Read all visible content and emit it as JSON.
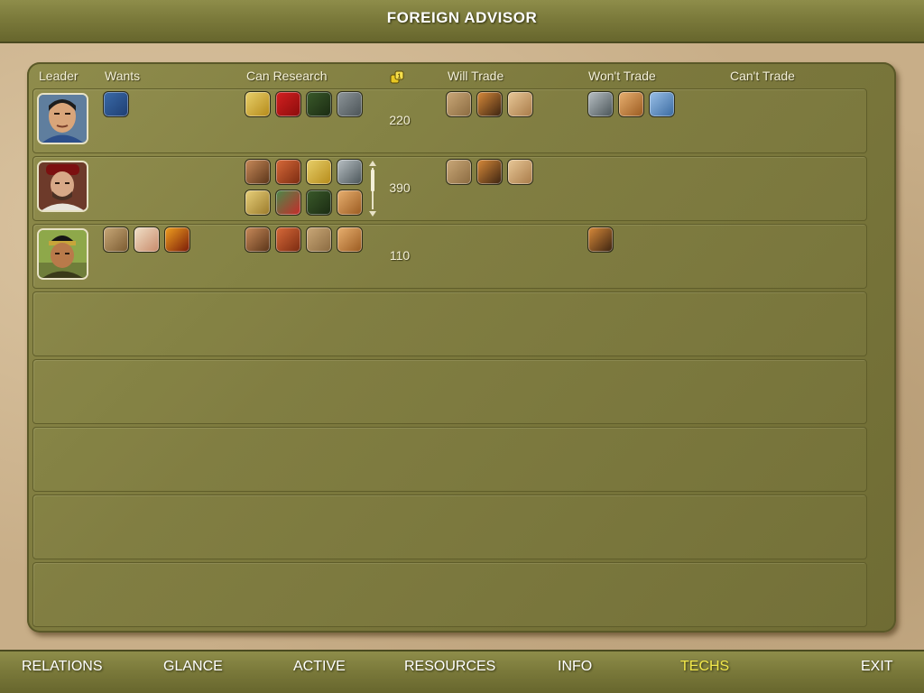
{
  "title": "FOREIGN ADVISOR",
  "headers": {
    "leader": "Leader",
    "wants": "Wants",
    "can_research": "Can Research",
    "will_trade": "Will Trade",
    "wont_trade": "Won't Trade",
    "cant_trade": "Can't Trade"
  },
  "gold_icon": "gold-coin-icon",
  "rows": [
    {
      "leader_icon": "leader-portrait-chinese",
      "wants": [
        "writing-tech-icon"
      ],
      "can_research": [
        "monarchy-tech-icon",
        "communism-tech-icon",
        "invention-tech-icon",
        "navigation-tech-icon"
      ],
      "gold": "220",
      "will_trade": [
        "philosophy-tech-icon",
        "theology-tech-icon",
        "sanitation-tech-icon"
      ],
      "wont_trade": [
        "theory-of-gravity-tech-icon",
        "astronomy-tech-icon",
        "medicine-tech-icon"
      ],
      "cant_trade": []
    },
    {
      "leader_icon": "leader-portrait-spanish",
      "wants": [],
      "can_research": [
        "feudalism-tech-icon",
        "chivalry-tech-icon",
        "monarchy-tech-icon",
        "theory-of-gravity-tech-icon",
        "banking-tech-icon",
        "education-tech-icon",
        "invention-tech-icon",
        "astronomy-tech-icon"
      ],
      "gold": "390",
      "will_trade": [
        "philosophy-tech-icon",
        "theology-tech-icon",
        "sanitation-tech-icon"
      ],
      "wont_trade": [],
      "cant_trade": []
    },
    {
      "leader_icon": "leader-portrait-mongol",
      "wants": [
        "engineering-tech-icon",
        "literacy-tech-icon",
        "metallurgy-tech-icon"
      ],
      "can_research": [
        "feudalism-tech-icon",
        "chivalry-tech-icon",
        "philosophy-tech-icon",
        "astronomy-tech-icon"
      ],
      "gold": "110",
      "will_trade": [],
      "wont_trade": [
        "theology-tech-icon"
      ],
      "cant_trade": []
    }
  ],
  "empty_rows": 5,
  "nav": [
    {
      "label": "RELATIONS",
      "active": false
    },
    {
      "label": "GLANCE",
      "active": false
    },
    {
      "label": "ACTIVE",
      "active": false
    },
    {
      "label": "RESOURCES",
      "active": false
    },
    {
      "label": "INFO",
      "active": false
    },
    {
      "label": "TECHS",
      "active": true
    },
    {
      "label": "EXIT",
      "active": false
    }
  ]
}
